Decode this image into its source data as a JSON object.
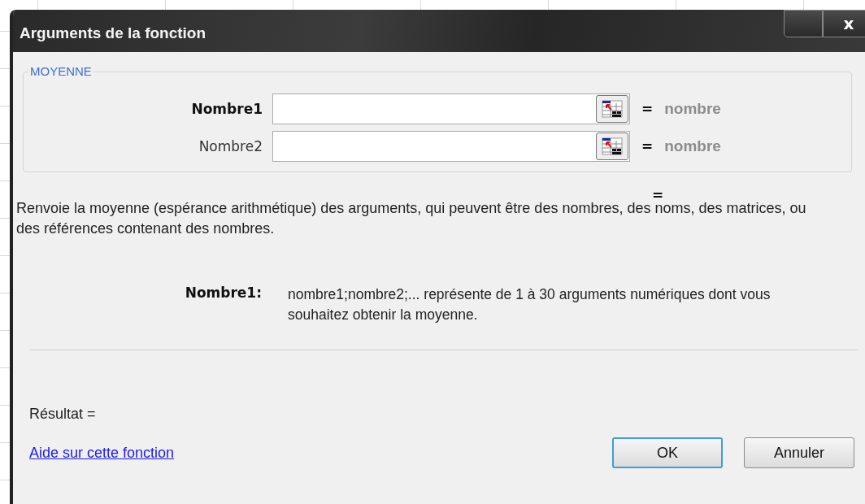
{
  "window": {
    "title": "Arguments de la fonction",
    "close": "x"
  },
  "function_name": "MOYENNE",
  "arguments": [
    {
      "label": "Nombre1",
      "active": true,
      "equals": "=",
      "hint": "nombre"
    },
    {
      "label": "Nombre2",
      "active": false,
      "equals": "=",
      "hint": "nombre"
    }
  ],
  "formula_result": "=",
  "description": "Renvoie la moyenne (espérance arithmétique) des arguments, qui peuvent être des nombres, des noms, des matrices, ou des références contenant des nombres.",
  "argument_help": {
    "label": "Nombre1:",
    "text": "nombre1;nombre2;... représente de 1 à 30 arguments numériques dont vous souhaitez obtenir la moyenne."
  },
  "result_label": "Résultat =",
  "help_link": "Aide sur cette fonction",
  "buttons": [
    {
      "label": "OK",
      "selected": true
    },
    {
      "label": "Annuler",
      "selected": false
    }
  ]
}
